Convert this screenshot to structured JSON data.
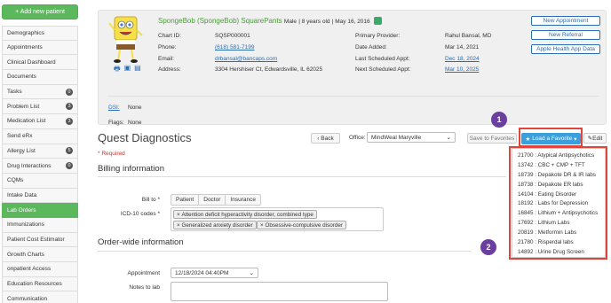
{
  "sidebar": {
    "add_button": "+ Add new patient",
    "items": [
      {
        "label": "Demographics",
        "badge": ""
      },
      {
        "label": "Appointments",
        "badge": ""
      },
      {
        "label": "Clinical Dashboard",
        "badge": ""
      },
      {
        "label": "Documents",
        "badge": ""
      },
      {
        "label": "Tasks",
        "badge": "0"
      },
      {
        "label": "Problem List",
        "badge": "3"
      },
      {
        "label": "Medication List",
        "badge": "3"
      },
      {
        "label": "Send eRx",
        "badge": ""
      },
      {
        "label": "Allergy List",
        "badge": "5"
      },
      {
        "label": "Drug Interactions",
        "badge": "0"
      },
      {
        "label": "CQMs",
        "badge": ""
      },
      {
        "label": "Intake Data",
        "badge": ""
      },
      {
        "label": "Lab Orders",
        "badge": ""
      },
      {
        "label": "Immunizations",
        "badge": ""
      },
      {
        "label": "Patient Cost Estimator",
        "badge": ""
      },
      {
        "label": "Growth Charts",
        "badge": ""
      },
      {
        "label": "onpatient Access",
        "badge": ""
      },
      {
        "label": "Education Resources",
        "badge": ""
      },
      {
        "label": "Communication",
        "badge": ""
      }
    ],
    "active_index": 12
  },
  "patient": {
    "name": "SpongeBob (SpongeBob) SquarePants",
    "sex": "Male",
    "age": "8 years old",
    "dob": "May 16, 2016",
    "chart_id_label": "Chart ID:",
    "chart_id": "SQSP000001",
    "phone_label": "Phone:",
    "phone": "(618) 581-7199",
    "email_label": "Email:",
    "email": "drbansal@bancaps.com",
    "address_label": "Address:",
    "address": "3304 Hershiser Ct, Edwardsville, IL 62025",
    "primary_provider_label": "Primary Provider:",
    "primary_provider": "Rahul Bansal, MD",
    "date_added_label": "Date Added:",
    "date_added": "Mar 14, 2021",
    "last_appt_label": "Last Scheduled Appt:",
    "last_appt": "Dec 18, 2024",
    "next_appt_label": "Next Scheduled Appt:",
    "next_appt": "Mar 10, 2025",
    "dsi_label": "DSI:",
    "dsi_value": "None",
    "flags_label": "Flags:",
    "flags_value": "None"
  },
  "actions": {
    "new_appointment": "New Appointment",
    "new_referral": "New Referral",
    "apple_health": "Apple Health App Data"
  },
  "lab": {
    "title": "Quest Diagnostics",
    "back_label": "Back",
    "office_label": "Office:",
    "office_value": "MindWeal Maryville",
    "save_favorites": "Save to Favorites",
    "load_favorite": "Load a Favorite",
    "edit_label": "Edit",
    "required_note": "* Required",
    "favorites": [
      "21700 : Atypical Antipsychotics",
      "13742 : CBC + CMP + TFT",
      "18739 : Depakote DR & IR labs",
      "18738 : Depakote ER labs",
      "14104 : Eating Disorder",
      "18192 : Labs for Depression",
      "16845 : Lithium + Antipsychotics",
      "17692 : Lithium Labs",
      "20819 : Metformin Labs",
      "21780 : Risperdal labs",
      "14892 : Urine Drug Screen"
    ]
  },
  "billing": {
    "section_title": "Billing information",
    "bill_to_label": "Bill to *",
    "bill_to_options": [
      "Patient",
      "Doctor",
      "Insurance"
    ],
    "icd_label": "ICD-10 codes *",
    "icd_codes": [
      "Attention deficit hyperactivity disorder, combined type",
      "Generalized anxiety disorder",
      "Obsessive-compulsive disorder"
    ]
  },
  "order_wide": {
    "section_title": "Order-wide information",
    "appointment_label": "Appointment",
    "appointment_value": "12/18/2024 04:40PM",
    "notes_label": "Notes to lab"
  },
  "callouts": [
    "1",
    "2"
  ],
  "colors": {
    "accent_green": "#5cb85c",
    "link_blue": "#2a6db0",
    "favorite_blue": "#3a9fdc",
    "callout_purple": "#6b3fa0",
    "highlight_red": "#e0443a"
  }
}
